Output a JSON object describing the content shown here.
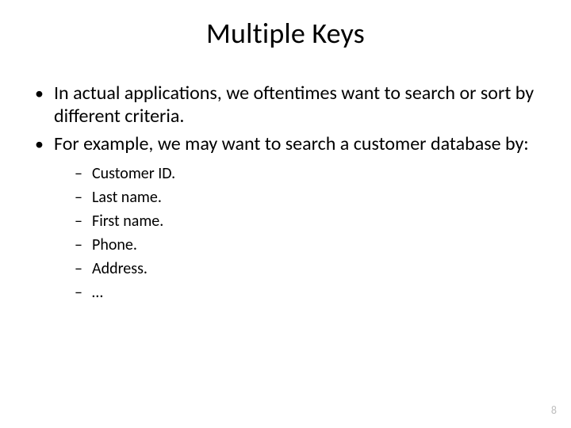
{
  "title": "Multiple Keys",
  "bullets": {
    "b1": "In actual applications, we oftentimes want to search or sort by different criteria.",
    "b2": "For example, we may want to search a customer database by:"
  },
  "sub": {
    "s1": "Customer ID.",
    "s2": "Last name.",
    "s3": "First name.",
    "s4": "Phone.",
    "s5": "Address.",
    "s6": "…"
  },
  "page_number": "8"
}
